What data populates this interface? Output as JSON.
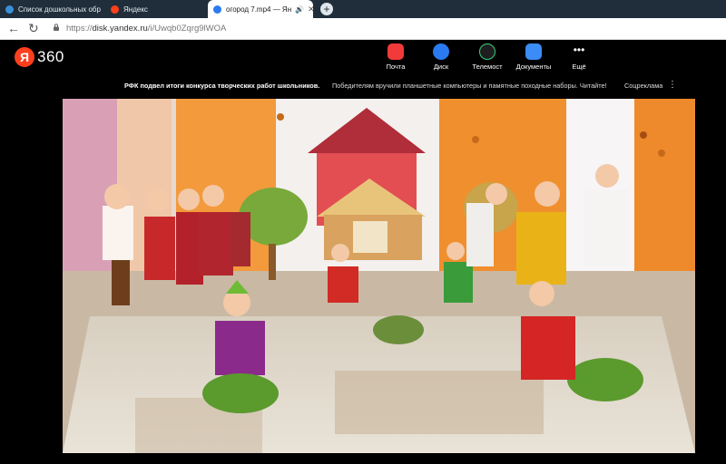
{
  "browser": {
    "tabs": [
      {
        "label": "Список дошкольных обр",
        "active": false,
        "favicon": "globe-icon"
      },
      {
        "label": "Яндекс",
        "active": false,
        "favicon": "yandex-icon"
      },
      {
        "label": "огород 7.mp4 — Ян",
        "active": true,
        "favicon": "disk-icon",
        "audio": "speaker-icon"
      }
    ],
    "new_tab": "+",
    "url_prefix": "https://",
    "url_main": "disk.yandex.ru",
    "url_path": "/i/Uwqb0Zqrg9lWOA"
  },
  "header": {
    "logo_letter": "Я",
    "logo_number": "360",
    "services": [
      {
        "label": "Почта",
        "icon": "mail-icon",
        "color": "#f33a3a"
      },
      {
        "label": "Диск",
        "icon": "disk-icon",
        "color": "#2b7bf0"
      },
      {
        "label": "Телемост",
        "icon": "telemost-icon",
        "color": "#1e1e1e"
      },
      {
        "label": "Документы",
        "icon": "documents-icon",
        "color": "#3b8cf6"
      },
      {
        "label": "Ещё",
        "icon": "more-icon",
        "color": "#000000"
      }
    ]
  },
  "news": {
    "headline": "РФК подвел итоги конкурса творческих работ школьников.",
    "description": "Победителям вручили планшетные компьютеры и памятные походные наборы. Читайте!",
    "ad_label": "Соцреклама",
    "more": "⋮"
  },
  "colors": {
    "tabbar": "#1f2e3a",
    "accent": "#fc3f1d",
    "page_bg": "#000000"
  }
}
